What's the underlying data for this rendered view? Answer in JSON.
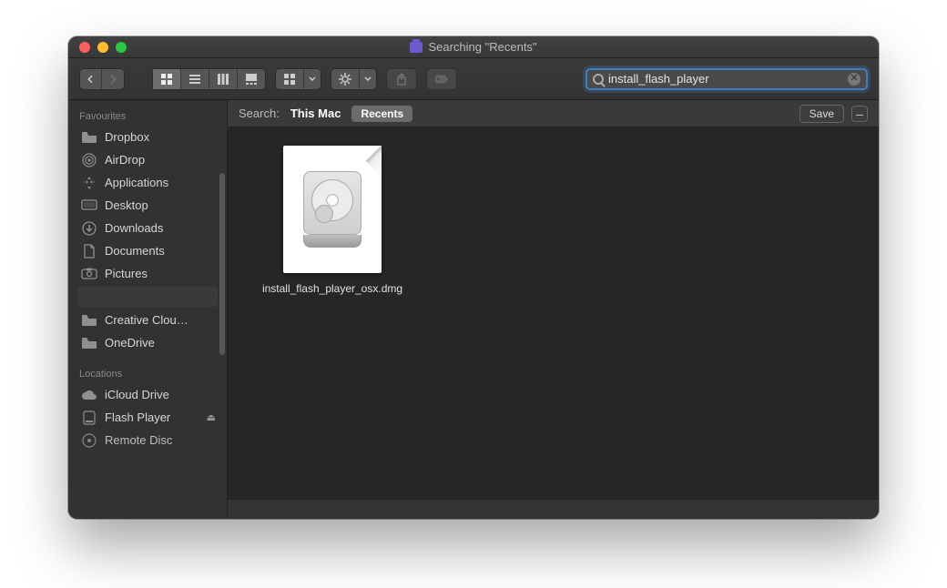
{
  "window": {
    "title_prefix": "Searching",
    "title_context": "\"Recents\""
  },
  "search": {
    "query": "install_flash_player"
  },
  "scopebar": {
    "label": "Search:",
    "this_mac": "This Mac",
    "recents": "Recents",
    "save": "Save"
  },
  "sidebar": {
    "favourites_header": "Favourites",
    "locations_header": "Locations",
    "favourites": [
      {
        "icon": "folder",
        "label": "Dropbox"
      },
      {
        "icon": "airdrop",
        "label": "AirDrop"
      },
      {
        "icon": "apps",
        "label": "Applications"
      },
      {
        "icon": "desktop",
        "label": "Desktop"
      },
      {
        "icon": "downloads",
        "label": "Downloads"
      },
      {
        "icon": "documents",
        "label": "Documents"
      },
      {
        "icon": "pictures",
        "label": "Pictures"
      }
    ],
    "extra": [
      {
        "icon": "folder",
        "label": "Creative Clou…"
      },
      {
        "icon": "folder",
        "label": "OneDrive"
      }
    ],
    "locations": [
      {
        "icon": "icloud",
        "label": "iCloud Drive"
      },
      {
        "icon": "disk",
        "label": "Flash Player",
        "eject": true
      },
      {
        "icon": "disc",
        "label": "Remote Disc"
      }
    ]
  },
  "files": [
    {
      "name": "install_flash_player_osx.dmg",
      "kind": "dmg"
    }
  ]
}
